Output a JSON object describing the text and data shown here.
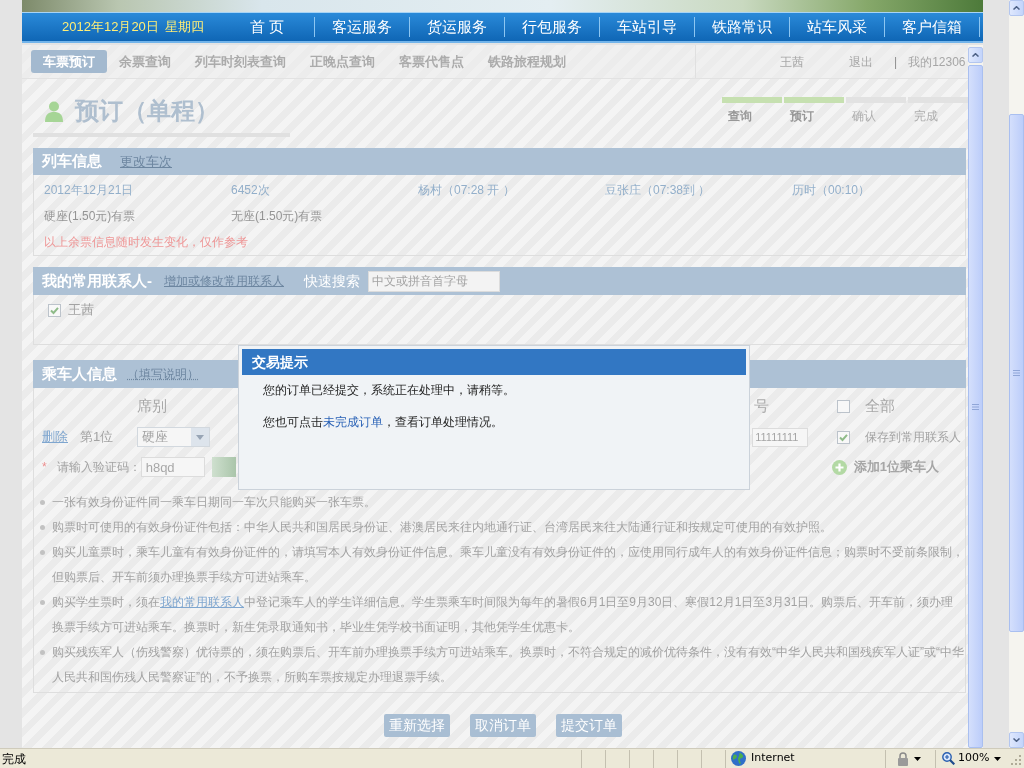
{
  "nav": {
    "date": "2012年12月20日",
    "weekday": "星期四",
    "items": [
      "首 页",
      "客运服务",
      "货运服务",
      "行包服务",
      "车站引导",
      "铁路常识",
      "站车风采",
      "客户信箱"
    ]
  },
  "tabs": [
    {
      "label": "车票预订",
      "selected": true
    },
    {
      "label": "余票查询",
      "selected": false
    },
    {
      "label": "列车时刻表查询",
      "selected": false
    },
    {
      "label": "正晚点查询",
      "selected": false
    },
    {
      "label": "客票代售点",
      "selected": false
    },
    {
      "label": "铁路旅程规划",
      "selected": false
    }
  ],
  "user_bar": {
    "user": "王茜",
    "logout": "退出",
    "separator": "|",
    "account": "我的12306"
  },
  "page_title": "预订（单程）",
  "steps": [
    {
      "label": "查询",
      "done": true
    },
    {
      "label": "预订",
      "done": true
    },
    {
      "label": "确认",
      "done": false
    },
    {
      "label": "完成",
      "done": false
    }
  ],
  "train_info": {
    "title": "列车信息",
    "change_link": "更改车次",
    "date": "2012年12月21日",
    "train": "6452次",
    "departure": "杨村（07:28 开 ）",
    "arrival": "豆张庄（07:38到 ）",
    "duration": "历时（00:10）",
    "seats": [
      "硬座(1.50元)有票",
      "无座(1.50元)有票"
    ],
    "notice": "以上余票信息随时发生变化，仅作参考"
  },
  "contacts": {
    "title": "我的常用联系人-",
    "edit_link": "增加或修改常用联系人",
    "search_label": "快速搜索",
    "search_placeholder": "中文或拼音首字母",
    "items": [
      {
        "name": "王茜",
        "checked": true
      }
    ]
  },
  "passengers": {
    "title": "乘车人信息",
    "help_link": "（填写说明）",
    "columns": [
      "席别",
      "号"
    ],
    "select_all": {
      "label": "全部",
      "checked": false
    },
    "rows": [
      {
        "delete_link": "删除",
        "position": "第1位",
        "seat": "硬座",
        "id_number": "11111111",
        "save_contact": {
          "label": "保存到常用联系人",
          "checked": true
        }
      }
    ],
    "captcha": {
      "required_mark": "*",
      "label": "请输入验证码：",
      "value": "h8qd"
    },
    "add_passenger": "添加1位乘车人"
  },
  "notes": [
    {
      "parts": [
        {
          "text": "一张有效身份证件同一乘车日期同一车次只能购买一张车票。",
          "link": false
        }
      ]
    },
    {
      "parts": [
        {
          "text": "购票时可使用的有效身份证件包括：中华人民共和国居民身份证、港澳居民来往内地通行证、台湾居民来往大陆通行证和按规定可使用的有效护照。",
          "link": false
        }
      ]
    },
    {
      "parts": [
        {
          "text": "购买儿童票时，乘车儿童有有效身份证件的，请填写本人有效身份证件信息。乘车儿童没有有效身份证件的，应使用同行成年人的有效身份证件信息；购票时不受前条限制，但购票后、开车前须办理换票手续方可进站乘车。",
          "link": false
        }
      ]
    },
    {
      "parts": [
        {
          "text": "购买学生票时，须在",
          "link": false
        },
        {
          "text": "我的常用联系人",
          "link": true
        },
        {
          "text": "中登记乘车人的学生详细信息。学生票乘车时间限为每年的暑假6月1日至9月30日、寒假12月1日至3月31日。购票后、开车前，须办理换票手续方可进站乘车。换票时，新生凭录取通知书，毕业生凭学校书面证明，其他凭学生优惠卡。",
          "link": false
        }
      ]
    },
    {
      "parts": [
        {
          "text": "购买残疾军人（伤残警察）优待票的，须在购票后、开车前办理换票手续方可进站乘车。换票时，不符合规定的减价优待条件，没有有效“中华人民共和国残疾军人证”或“中华人民共和国伤残人民警察证”的，不予换票，所购车票按规定办理退票手续。",
          "link": false
        }
      ]
    }
  ],
  "buttons": [
    "重新选择",
    "取消订单",
    "提交订单"
  ],
  "dialog": {
    "title": "交易提示",
    "message": "您的订单已经提交，系统正在处理中，请稍等。",
    "hint_before": "您也可点击",
    "hint_link": "未完成订单",
    "hint_after": "，查看订单处理情况。"
  },
  "status_bar": {
    "text": "完成",
    "zone": "Internet",
    "zoom": "100%"
  }
}
